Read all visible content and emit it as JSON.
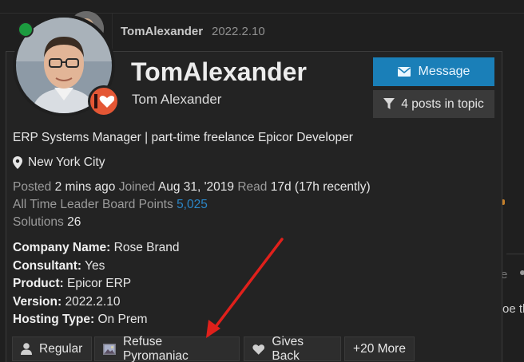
{
  "post": {
    "author": "TomAlexander",
    "date": "2022.2.10",
    "edge_letter": "e",
    "edge_text": "oe th"
  },
  "card": {
    "username": "TomAlexander",
    "full_name": "Tom Alexander",
    "message_button": "Message",
    "filter_button": "4 posts in topic",
    "bio": "ERP Systems Manager | part-time freelance Epicor Developer",
    "location": "New York City",
    "stats": {
      "posted_label": "Posted",
      "posted_value": "2 mins ago",
      "joined_label": "Joined",
      "joined_value": "Aug 31, '2019",
      "read_label": "Read",
      "read_value": "17d (17h recently)",
      "points_label": "All Time Leader Board Points",
      "points_value": "5,025",
      "solutions_label": "Solutions",
      "solutions_value": "26"
    },
    "fields": [
      {
        "label": "Company Name:",
        "value": "Rose Brand"
      },
      {
        "label": "Consultant:",
        "value": "Yes"
      },
      {
        "label": "Product:",
        "value": "Epicor ERP"
      },
      {
        "label": "Version:",
        "value": "2022.2.10"
      },
      {
        "label": "Hosting Type:",
        "value": "On Prem"
      }
    ],
    "badges": [
      {
        "label": "Regular",
        "icon": "user-icon"
      },
      {
        "label": "Refuse Pyromaniac",
        "icon": "image-icon"
      },
      {
        "label": "Gives Back",
        "icon": "heart-icon"
      },
      {
        "label": "+20 More"
      }
    ]
  },
  "colors": {
    "background": "#1f1f1f",
    "card": "#232323",
    "accent_blue": "#1a7fb8",
    "link_blue": "#2b86c7",
    "online_green": "#1c9b3f",
    "status_orange": "#e45735",
    "annotation_red": "#e0201b"
  }
}
